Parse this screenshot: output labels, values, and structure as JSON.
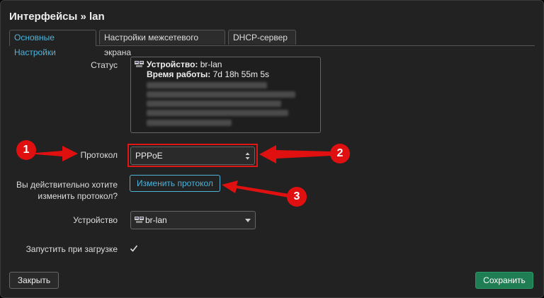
{
  "dialog": {
    "title": "Интерфейсы » lan"
  },
  "tabs": [
    {
      "label": "Основные Настройки"
    },
    {
      "label": "Настройки межсетевого экрана"
    },
    {
      "label": "DHCP-сервер"
    }
  ],
  "status": {
    "label": "Статус",
    "device_key": "Устройство:",
    "device_value": " br-lan",
    "uptime_key": "Время работы:",
    "uptime_value": " 7d 18h 55m 5s"
  },
  "protocol": {
    "label": "Протокол",
    "value": "PPPoE"
  },
  "confirm": {
    "label_line1": "Вы действительно хотите",
    "label_line2": "изменить протокол?",
    "button": "Изменить протокол"
  },
  "device": {
    "label": "Устройство",
    "value": "br-lan"
  },
  "autostart": {
    "label": "Запустить при загрузке",
    "checked": true
  },
  "footer": {
    "close": "Закрыть",
    "save": "Сохранить"
  },
  "annotations": {
    "marker1": "1",
    "marker2": "2",
    "marker3": "3"
  },
  "colors": {
    "accent": "#4fb3d9",
    "save": "#1e7d52",
    "annotation": "#e01010"
  }
}
